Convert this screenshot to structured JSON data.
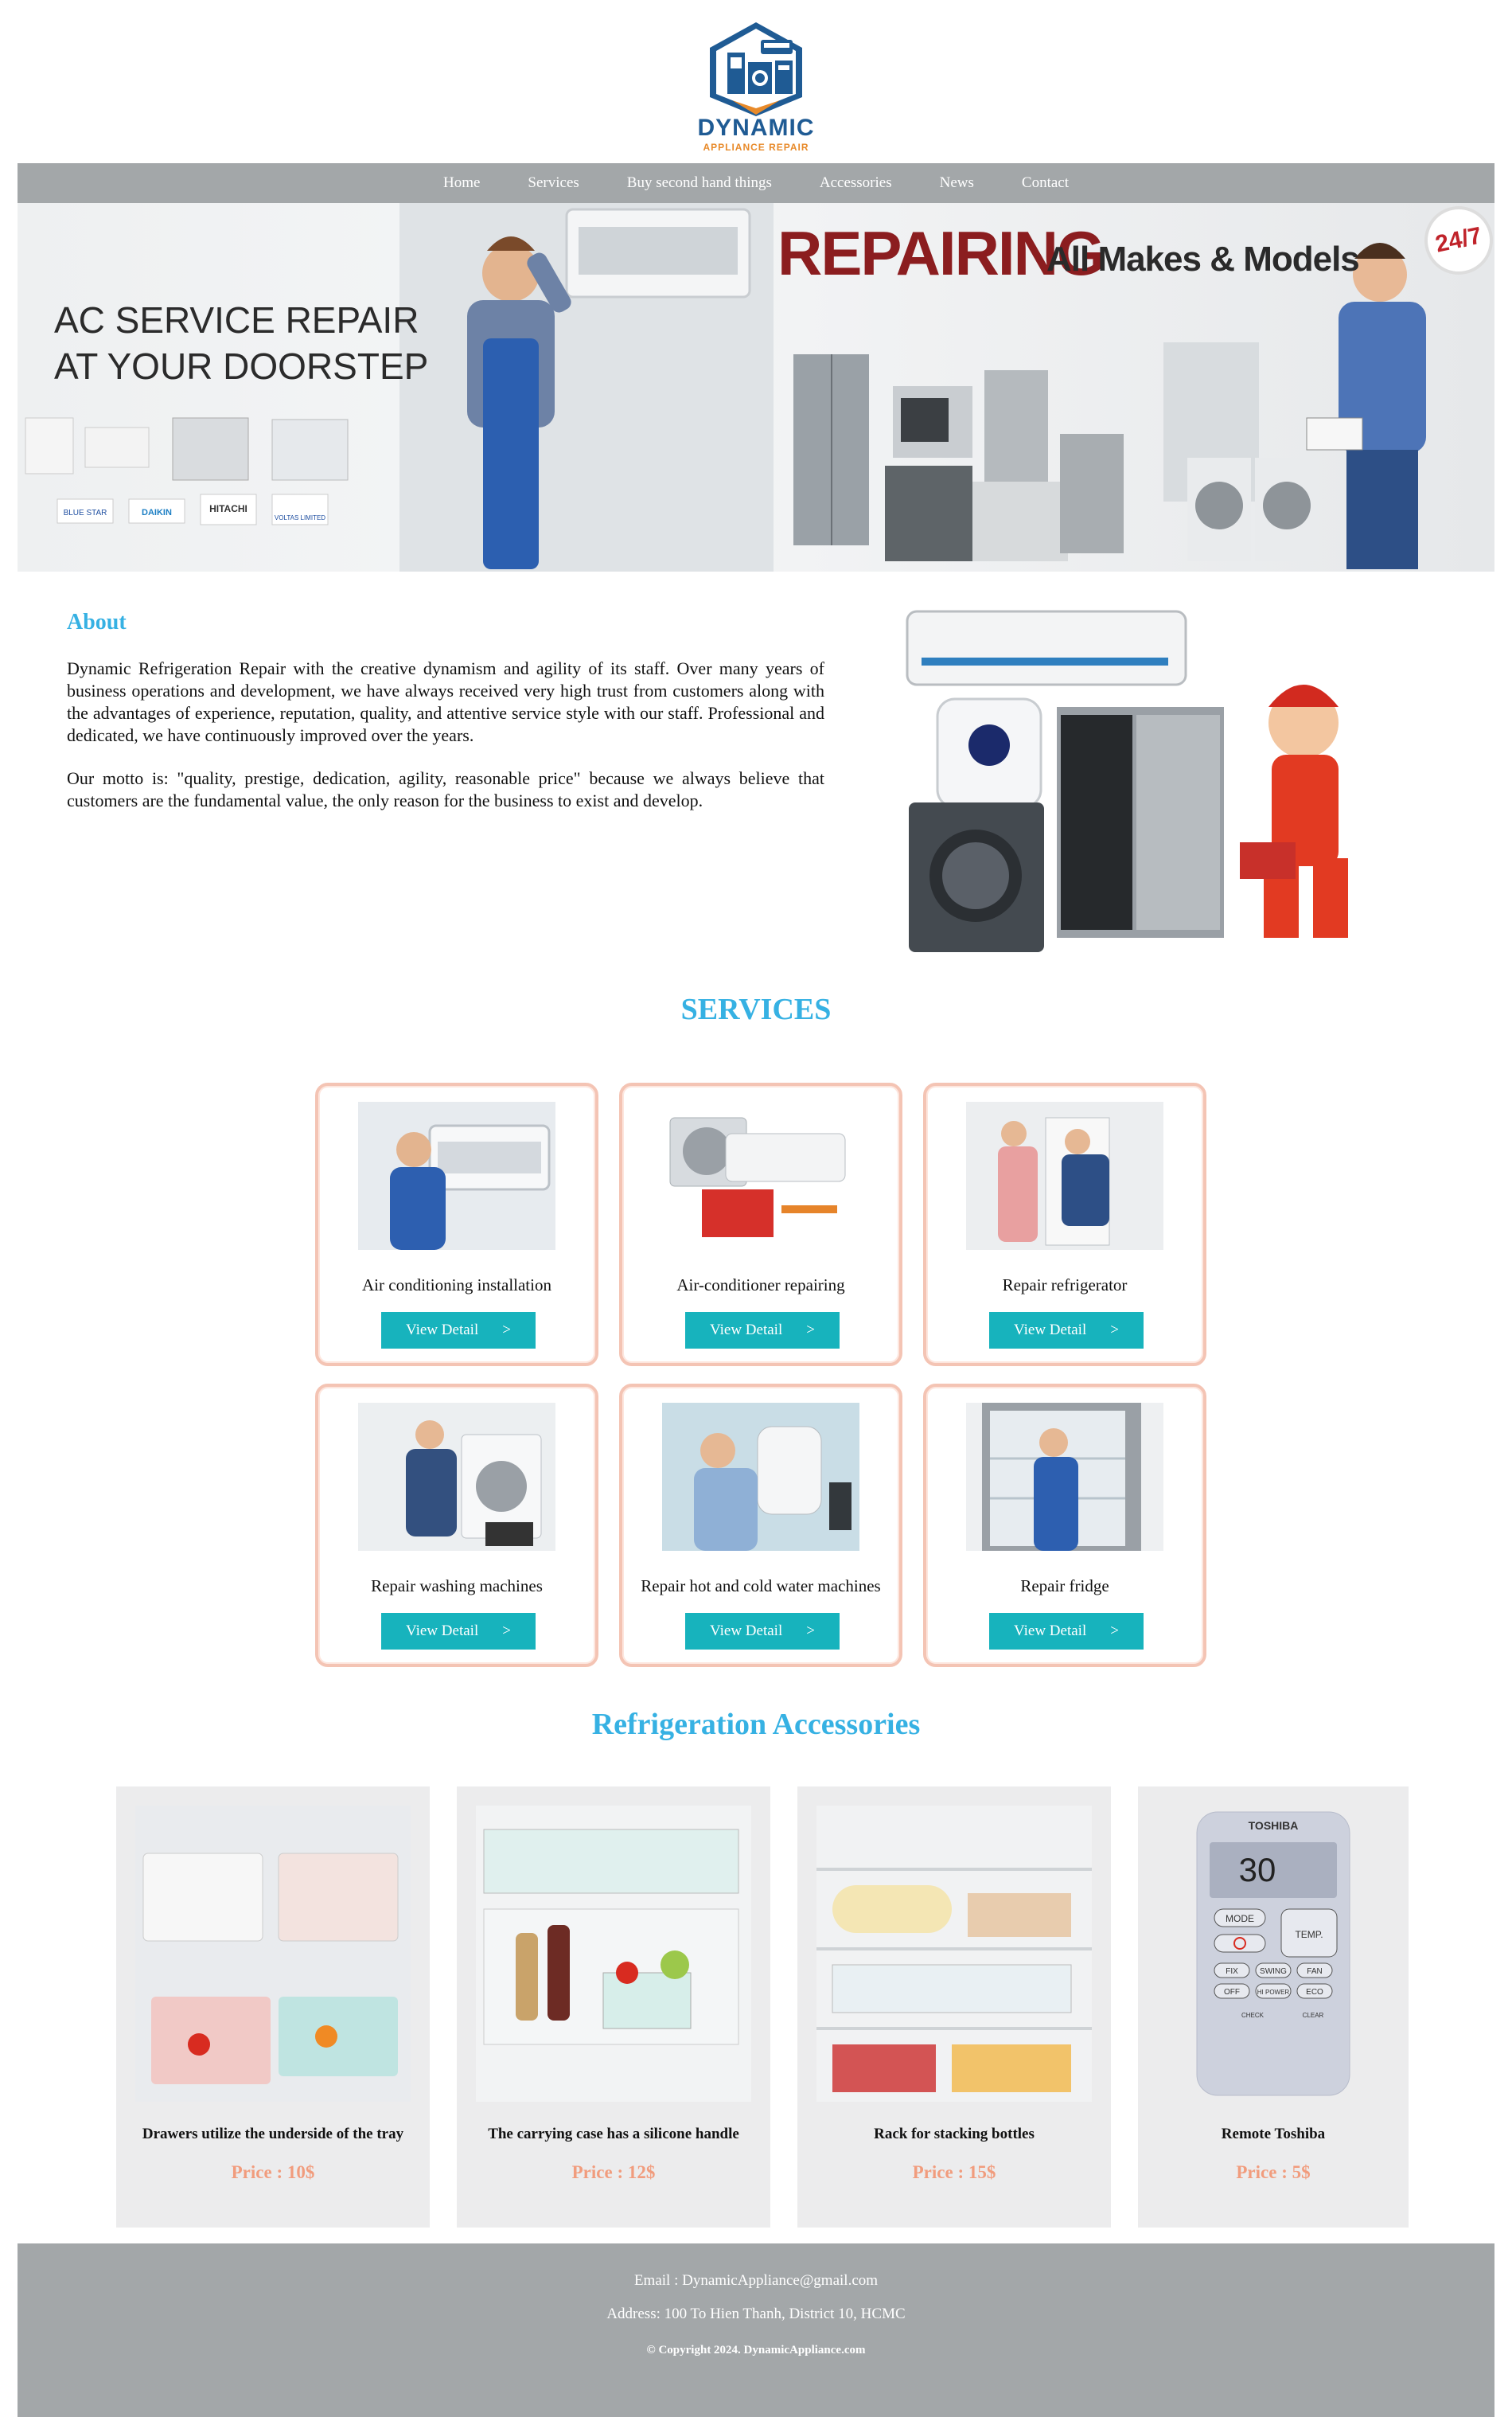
{
  "brand": {
    "name": "DYNAMIC",
    "tagline": "APPLIANCE REPAIR"
  },
  "nav": {
    "items": [
      {
        "label": "Home"
      },
      {
        "label": "Services"
      },
      {
        "label": "Buy second hand things"
      },
      {
        "label": "Accessories"
      },
      {
        "label": "News"
      },
      {
        "label": "Contact"
      }
    ]
  },
  "banner": {
    "left_line1": "AC SERVICE REPAIR",
    "left_line2": "AT YOUR DOORSTEP",
    "headline": "REPAIRING",
    "subheadline": "All Makes & Models",
    "badge": "24/7",
    "brands": [
      "BLUE STAR",
      "DAIKIN",
      "HITACHI",
      "VOLTAS LIMITED"
    ]
  },
  "about": {
    "title": "About",
    "paragraph1": "Dynamic Refrigeration Repair with the creative dynamism and agility of its staff. Over many years of business operations and development, we have always received very high trust from customers along with the advantages of experience, reputation, quality, and attentive service style with our staff. Professional and dedicated, we have continuously improved over the years.",
    "paragraph2": "Our motto is: \"quality, prestige, dedication, agility, reasonable price\" because we always believe that customers are the fundamental value, the only reason for the business to exist and develop."
  },
  "services": {
    "title": "SERVICES",
    "button_label": "View Detail",
    "button_arrow": ">",
    "items": [
      {
        "name": "Air conditioning installation"
      },
      {
        "name": "Air-conditioner repairing"
      },
      {
        "name": "Repair refrigerator"
      },
      {
        "name": "Repair washing machines"
      },
      {
        "name": "Repair hot and cold water machines"
      },
      {
        "name": "Repair fridge"
      }
    ]
  },
  "accessories": {
    "title": "Refrigeration Accessories",
    "items": [
      {
        "name": "Drawers utilize the underside of the tray",
        "price": "Price : 10$"
      },
      {
        "name": "The carrying case has a silicone handle",
        "price": "Price : 12$"
      },
      {
        "name": "Rack for stacking bottles",
        "price": "Price : 15$"
      },
      {
        "name": "Remote Toshiba",
        "price": "Price : 5$"
      }
    ],
    "remote": {
      "brand": "TOSHIBA",
      "display": "30",
      "mode": "MODE",
      "temp": "TEMP.",
      "fix": "FIX",
      "swing": "SWING",
      "fan": "FAN",
      "off": "OFF",
      "hipower": "HI POWER",
      "eco": "ECO",
      "check": "CHECK",
      "clear": "CLEAR"
    }
  },
  "footer": {
    "email": "Email : DynamicAppliance@gmail.com",
    "address": "Address: 100 To Hien Thanh, District 10, HCMC",
    "copyright": "© Copyright 2024. DynamicAppliance.com"
  },
  "colors": {
    "accent": "#36b1e3",
    "nav_bg": "#a3a7a9",
    "button": "#17b3bd",
    "card_border": "#f4c4b4",
    "price": "#f19c7d",
    "banner_red": "#8b1d1f"
  }
}
